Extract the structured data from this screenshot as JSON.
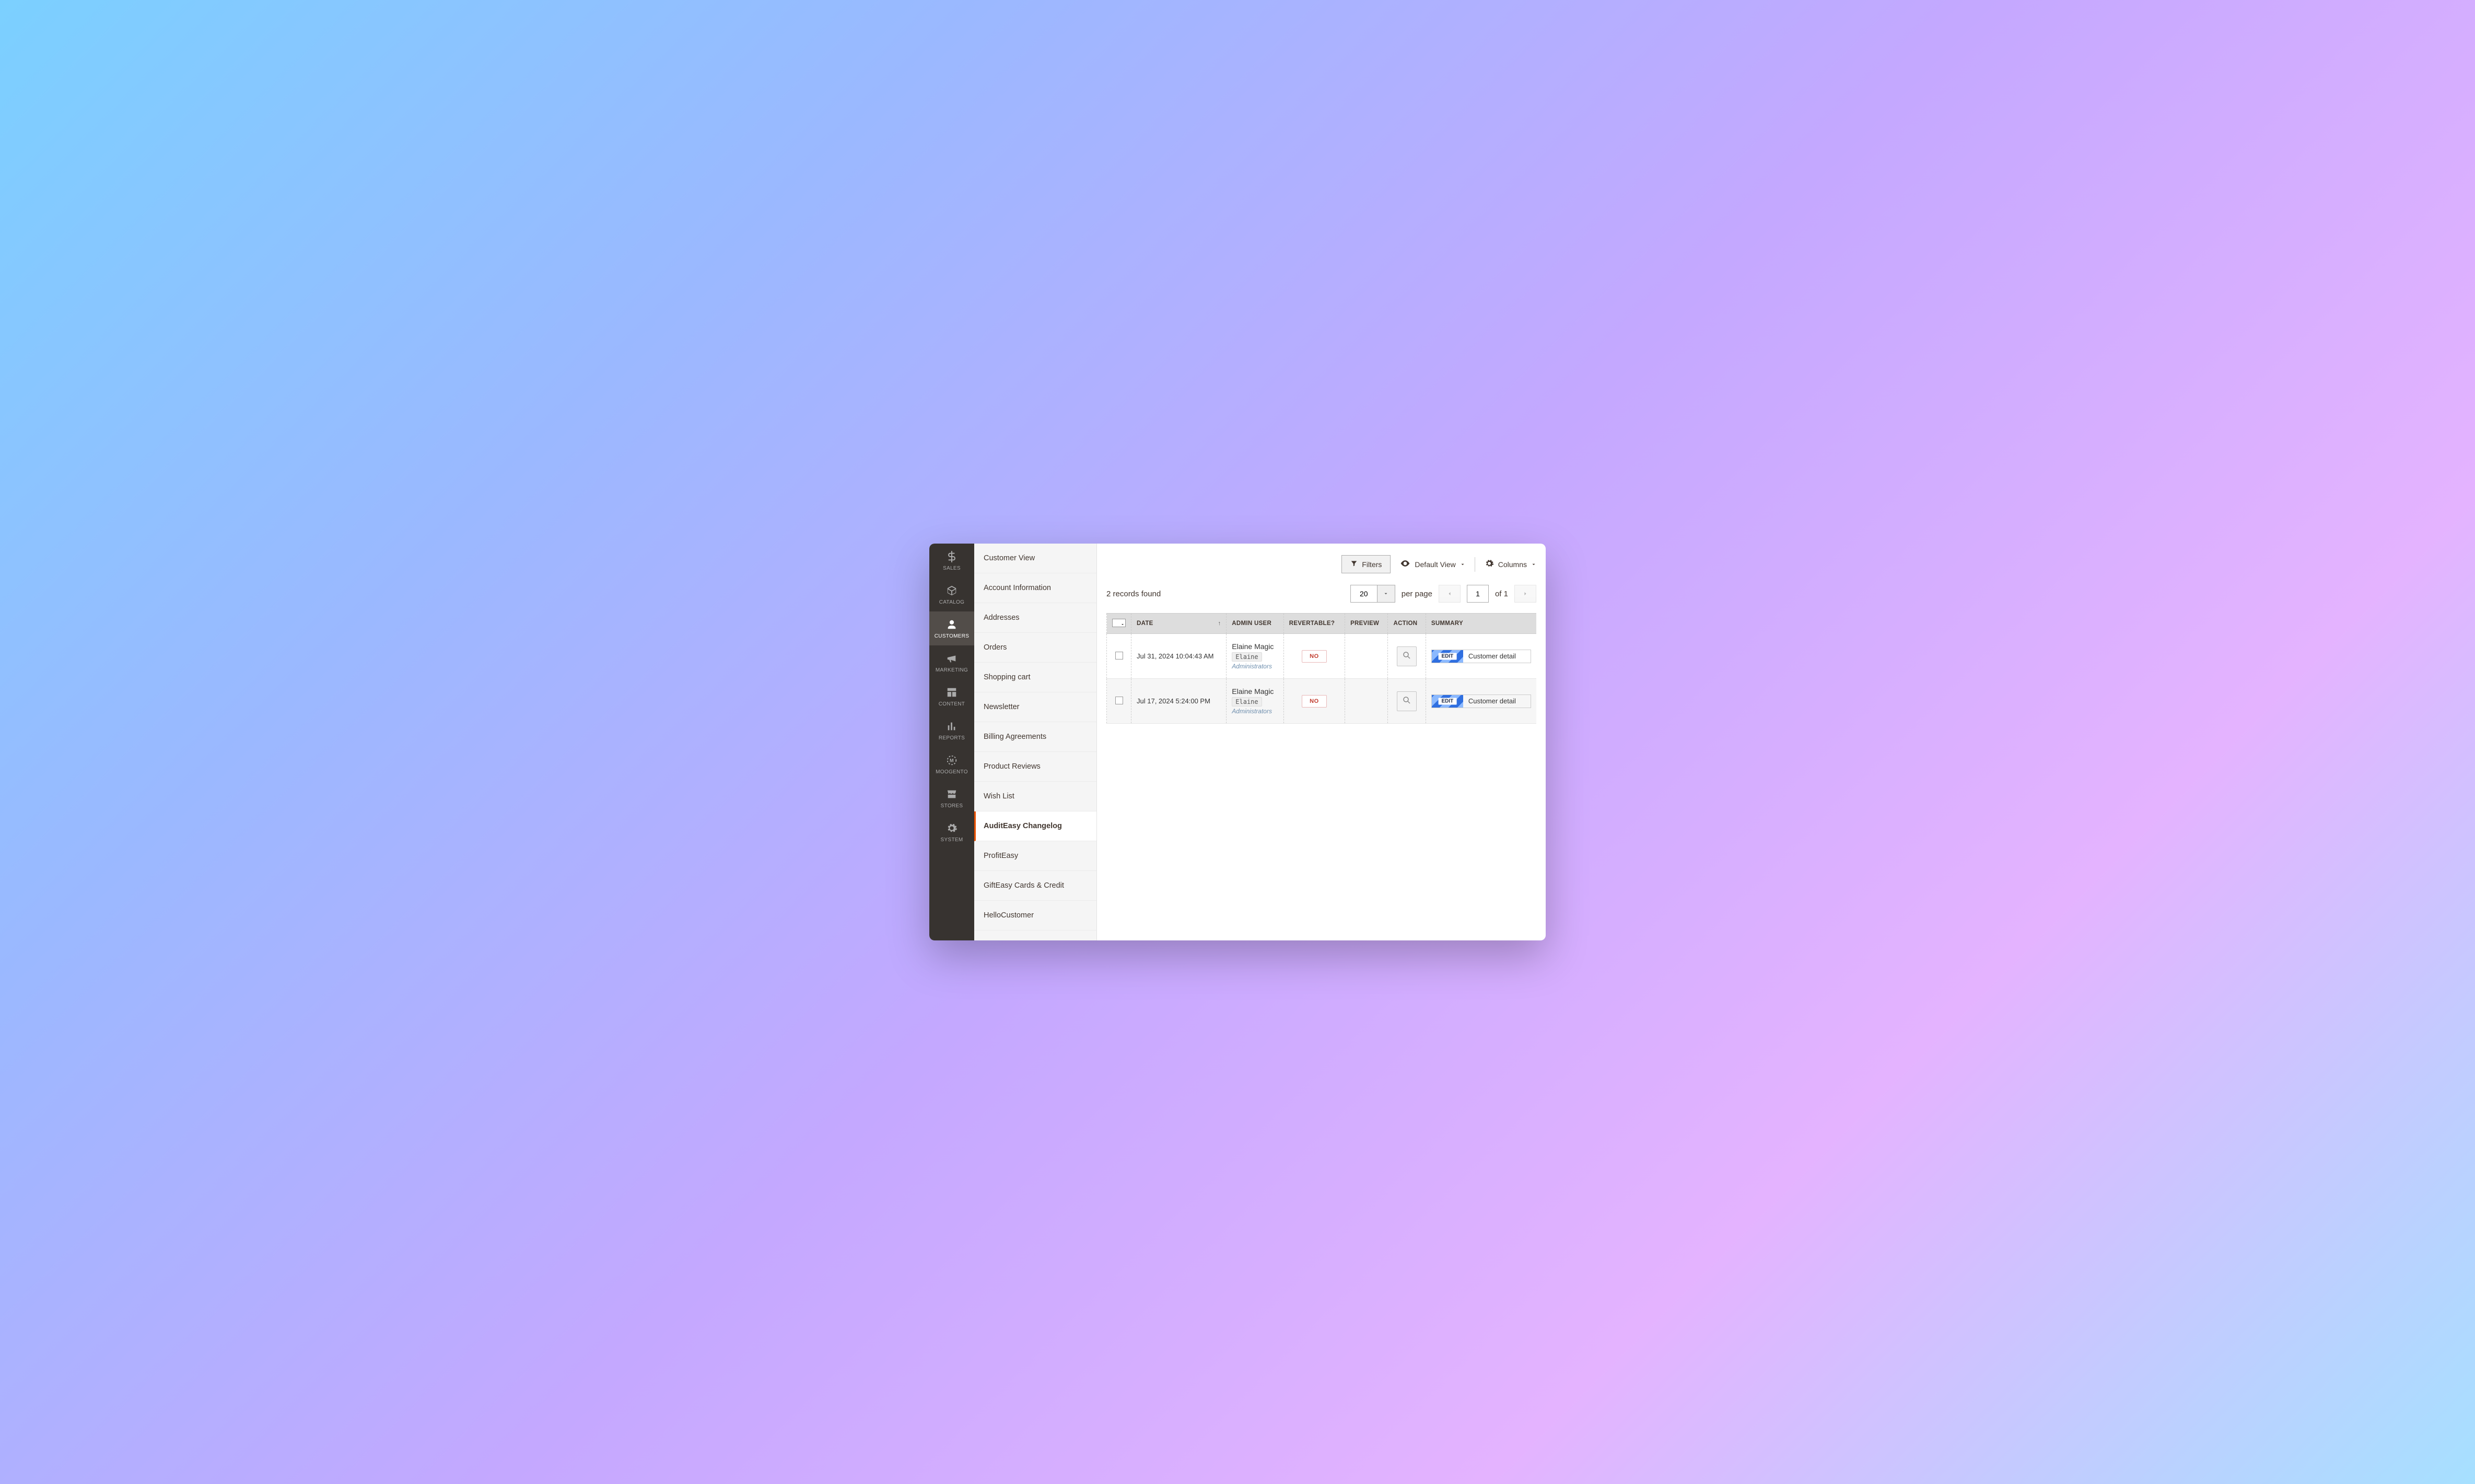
{
  "mainnav": [
    {
      "id": "sales",
      "label": "SALES"
    },
    {
      "id": "catalog",
      "label": "CATALOG"
    },
    {
      "id": "customers",
      "label": "CUSTOMERS",
      "active": true
    },
    {
      "id": "marketing",
      "label": "MARKETING"
    },
    {
      "id": "content",
      "label": "CONTENT"
    },
    {
      "id": "reports",
      "label": "REPORTS"
    },
    {
      "id": "moogento",
      "label": "MOOGENTO"
    },
    {
      "id": "stores",
      "label": "STORES"
    },
    {
      "id": "system",
      "label": "SYSTEM"
    }
  ],
  "subnav": [
    {
      "label": "Customer View"
    },
    {
      "label": "Account Information"
    },
    {
      "label": "Addresses"
    },
    {
      "label": "Orders"
    },
    {
      "label": "Shopping cart"
    },
    {
      "label": "Newsletter"
    },
    {
      "label": "Billing Agreements"
    },
    {
      "label": "Product Reviews"
    },
    {
      "label": "Wish List"
    },
    {
      "label": "AuditEasy Changelog",
      "active": true
    },
    {
      "label": "ProfitEasy"
    },
    {
      "label": "GiftEasy Cards & Credit"
    },
    {
      "label": "HelloCustomer"
    }
  ],
  "toolbar": {
    "filters": "Filters",
    "defaultView": "Default View",
    "columns": "Columns"
  },
  "listing": {
    "records_found": "2 records found",
    "page_size": "20",
    "per_page": "per page",
    "current_page": "1",
    "of": "of",
    "total_pages": "1"
  },
  "columns": {
    "date": "DATE",
    "admin_user": "ADMIN USER",
    "revertable": "REVERTABLE?",
    "preview": "PREVIEW",
    "action": "ACTION",
    "summary": "SUMMARY"
  },
  "rows": [
    {
      "date": "Jul 31, 2024 10:04:43 AM",
      "user_name": "Elaine Magic",
      "user_login": "Elaine",
      "user_role": "Administrators",
      "revertable": "NO",
      "edit": "EDIT",
      "summary": "Customer detail"
    },
    {
      "date": "Jul 17, 2024 5:24:00 PM",
      "user_name": "Elaine Magic",
      "user_login": "Elaine",
      "user_role": "Administrators",
      "revertable": "NO",
      "edit": "EDIT",
      "summary": "Customer detail"
    }
  ]
}
